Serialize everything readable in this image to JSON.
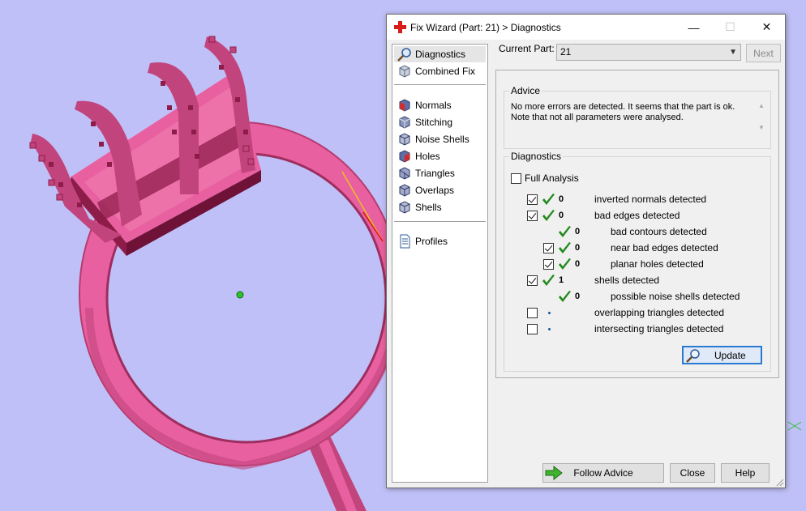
{
  "colors": {
    "viewport_bg": "#c0c0f8",
    "model": "#e8609f",
    "model_dark": "#8e1c49",
    "dialog_bg": "#f0f0f0",
    "accent": "#2a7ad2",
    "check_green": "#24891c"
  },
  "window": {
    "title": "Fix Wizard (Part: 21) > Diagnostics",
    "icon": "red-cross-icon",
    "minimize": "—",
    "maximize": "☐",
    "close": "✕"
  },
  "nav": {
    "items": [
      {
        "label": "Diagnostics",
        "icon": "magnifier-icon",
        "selected": true
      },
      {
        "label": "Combined Fix",
        "icon": "cube-icon"
      },
      {
        "label": "Normals",
        "icon": "cube-red-icon"
      },
      {
        "label": "Stitching",
        "icon": "cube-icon"
      },
      {
        "label": "Noise Shells",
        "icon": "cube-icon"
      },
      {
        "label": "Holes",
        "icon": "cube-red-icon"
      },
      {
        "label": "Triangles",
        "icon": "cube-icon"
      },
      {
        "label": "Overlaps",
        "icon": "cube-icon"
      },
      {
        "label": "Shells",
        "icon": "cube-icon"
      },
      {
        "label": "Profiles",
        "icon": "document-icon"
      }
    ]
  },
  "part": {
    "label": "Current Part:",
    "value": "21",
    "next": "Next"
  },
  "advice": {
    "title": "Advice",
    "line1": "No more errors are detected. It seems that the part is ok.",
    "line2": "Note that not all parameters were analysed."
  },
  "diagnostics": {
    "title": "Diagnostics",
    "full_analysis": "Full Analysis",
    "rows": [
      {
        "checkbox": true,
        "checked": true,
        "status": "ok",
        "count": "0",
        "label": "inverted normals detected",
        "indent": 0
      },
      {
        "checkbox": true,
        "checked": true,
        "status": "ok",
        "count": "0",
        "label": "bad edges detected",
        "indent": 0
      },
      {
        "checkbox": false,
        "status": "ok",
        "count": "0",
        "label": "bad contours detected",
        "indent": 1
      },
      {
        "checkbox": true,
        "checked": true,
        "status": "ok",
        "count": "0",
        "label": "near bad edges detected",
        "indent": 1
      },
      {
        "checkbox": true,
        "checked": true,
        "status": "ok",
        "count": "0",
        "label": "planar holes detected",
        "indent": 1
      },
      {
        "checkbox": true,
        "checked": true,
        "status": "ok",
        "count": "1",
        "label": "shells detected",
        "indent": 0
      },
      {
        "checkbox": false,
        "status": "ok",
        "count": "0",
        "label": "possible noise shells detected",
        "indent": 1
      },
      {
        "checkbox": true,
        "checked": false,
        "status": "none",
        "count": "",
        "label": "overlapping triangles detected",
        "indent": 0
      },
      {
        "checkbox": true,
        "checked": false,
        "status": "none",
        "count": "",
        "label": "intersecting triangles detected",
        "indent": 0
      }
    ],
    "update": "Update"
  },
  "footer": {
    "follow_advice": "Follow Advice",
    "close": "Close",
    "help": "Help"
  }
}
